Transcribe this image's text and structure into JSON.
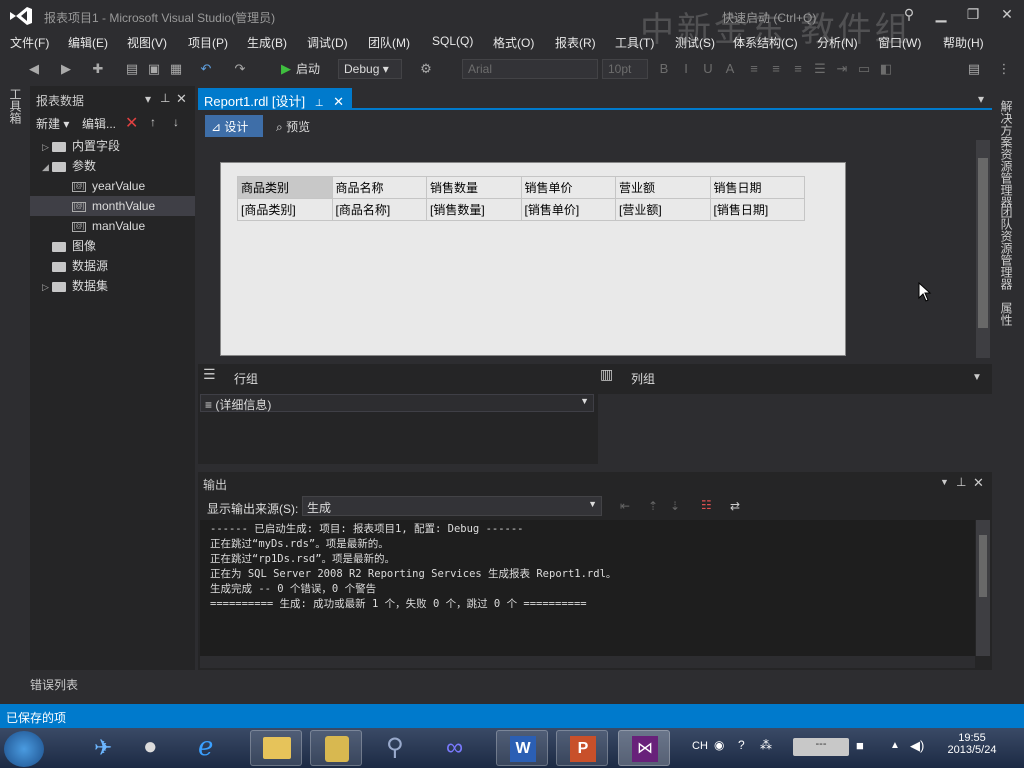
{
  "window": {
    "title": "报表项目1 - Microsoft Visual Studio(管理员)",
    "quick_launch": "快速启动 (Ctrl+Q)",
    "watermark": "中新金东 教件组"
  },
  "menu": [
    "文件(F)",
    "编辑(E)",
    "视图(V)",
    "项目(P)",
    "生成(B)",
    "调试(D)",
    "团队(M)",
    "SQL(Q)",
    "格式(O)",
    "报表(R)",
    "工具(T)",
    "测试(S)",
    "体系结构(C)",
    "分析(N)",
    "窗口(W)",
    "帮助(H)"
  ],
  "toolbar": {
    "start_label": "启动",
    "config": "Debug",
    "font": "Arial",
    "font_size": "10pt"
  },
  "toolbox_tab": "工具箱",
  "report_data": {
    "title": "报表数据",
    "new_label": "新建",
    "edit_label": "编辑...",
    "tree": [
      {
        "label": "内置字段",
        "type": "folder",
        "level": 0,
        "expander": "▷"
      },
      {
        "label": "参数",
        "type": "folder",
        "level": 0,
        "expander": "◢"
      },
      {
        "label": "yearValue",
        "type": "param",
        "level": 1,
        "expander": ""
      },
      {
        "label": "monthValue",
        "type": "param",
        "level": 1,
        "expander": "",
        "selected": true
      },
      {
        "label": "manValue",
        "type": "param",
        "level": 1,
        "expander": ""
      },
      {
        "label": "图像",
        "type": "folder",
        "level": 0,
        "expander": ""
      },
      {
        "label": "数据源",
        "type": "folder",
        "level": 0,
        "expander": ""
      },
      {
        "label": "数据集",
        "type": "folder",
        "level": 0,
        "expander": "▷"
      }
    ]
  },
  "doc_tab": "Report1.rdl [设计]",
  "view_buttons": {
    "design": "设计",
    "preview": "预览"
  },
  "report_table": {
    "headers": [
      "商品类别",
      "商品名称",
      "销售数量",
      "销售单价",
      "营业额",
      "销售日期"
    ],
    "fields": [
      "[商品类别]",
      "[商品名称]",
      "[销售数量]",
      "[销售单价]",
      "[营业额]",
      "[销售日期]"
    ]
  },
  "groups": {
    "row_label": "行组",
    "col_label": "列组",
    "row_item": "≡ (详细信息)"
  },
  "output": {
    "title": "输出",
    "source_label": "显示输出来源(S):",
    "source_value": "生成",
    "lines": [
      "------ 已启动生成: 项目: 报表项目1, 配置: Debug ------",
      "正在跳过“myDs.rds”。项是最新的。",
      "正在跳过“rp1Ds.rsd”。项是最新的。",
      "正在为 SQL Server 2008 R2 Reporting Services 生成报表 Report1.rdl。",
      "生成完成 -- 0 个错误，0 个警告",
      "========== 生成: 成功或最新 1 个，失败 0 个，跳过 0 个 =========="
    ]
  },
  "right_tabs": [
    "解决方案资源管理器",
    "团队资源管理器",
    "属性"
  ],
  "error_list": "错误列表",
  "status": "已保存的项",
  "tray": {
    "lang": "CH",
    "time": "19:55",
    "date": "2013/5/24"
  }
}
